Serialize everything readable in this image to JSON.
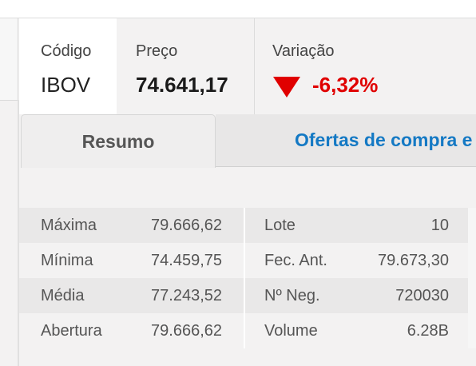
{
  "quote": {
    "code_label": "Código",
    "code_value": "IBOV",
    "price_label": "Preço",
    "price_value": "74.641,17",
    "variation_label": "Variação",
    "variation_value": "-6,32%",
    "variation_icon": "down-triangle-icon",
    "variation_color": "#e00000"
  },
  "tabs": [
    {
      "label": "Resumo",
      "active": true
    },
    {
      "label": "Ofertas de compra e",
      "active": false
    }
  ],
  "stats": {
    "rows": [
      {
        "label1": "Máxima",
        "value1": "79.666,62",
        "label2": "Lote",
        "value2": "10"
      },
      {
        "label1": "Mínima",
        "value1": "74.459,75",
        "label2": "Fec. Ant.",
        "value2": "79.673,30"
      },
      {
        "label1": "Média",
        "value1": "77.243,52",
        "label2": "Nº Neg.",
        "value2": "720030"
      },
      {
        "label1": "Abertura",
        "value1": "79.666,62",
        "label2": "Volume",
        "value2": "6.28B"
      }
    ]
  },
  "colors": {
    "link": "#1479c4",
    "negative": "#e00000"
  }
}
